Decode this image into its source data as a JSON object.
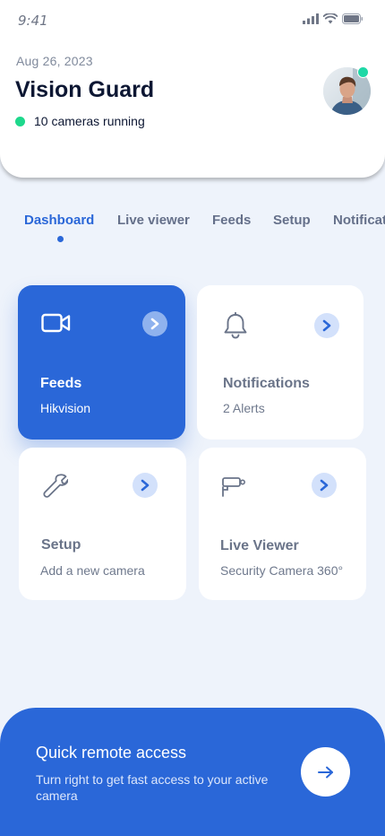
{
  "status_bar": {
    "time": "9:41",
    "icons": [
      "signal-icon",
      "wifi-icon",
      "battery-icon"
    ]
  },
  "header": {
    "date": "Aug 26, 2023",
    "title": "Vision Guard",
    "status_text": "10 cameras running",
    "status_color": "#1ed88c"
  },
  "tabs": [
    {
      "label": "Dashboard",
      "active": true
    },
    {
      "label": "Live viewer",
      "active": false
    },
    {
      "label": "Feeds",
      "active": false
    },
    {
      "label": "Setup",
      "active": false
    },
    {
      "label": "Notifications",
      "active": false
    }
  ],
  "cards": [
    {
      "title": "Feeds",
      "subtitle": "Hikvision",
      "icon": "video-camera-icon",
      "highlighted": true
    },
    {
      "title": "Notifications",
      "subtitle": "2 Alerts",
      "icon": "bell-icon",
      "highlighted": false
    },
    {
      "title": "Setup",
      "subtitle": "Add a new camera",
      "icon": "wrench-icon",
      "highlighted": false
    },
    {
      "title": "Live Viewer",
      "subtitle": "Security Camera 360°",
      "icon": "cctv-camera-icon",
      "highlighted": false
    }
  ],
  "quick_access": {
    "title": "Quick remote access",
    "description": "Turn right to get fast access to your active camera",
    "button_icon": "arrow-right-icon"
  },
  "colors": {
    "accent": "#2a67d8",
    "background": "#eef3fb",
    "online": "#1ed88c"
  }
}
